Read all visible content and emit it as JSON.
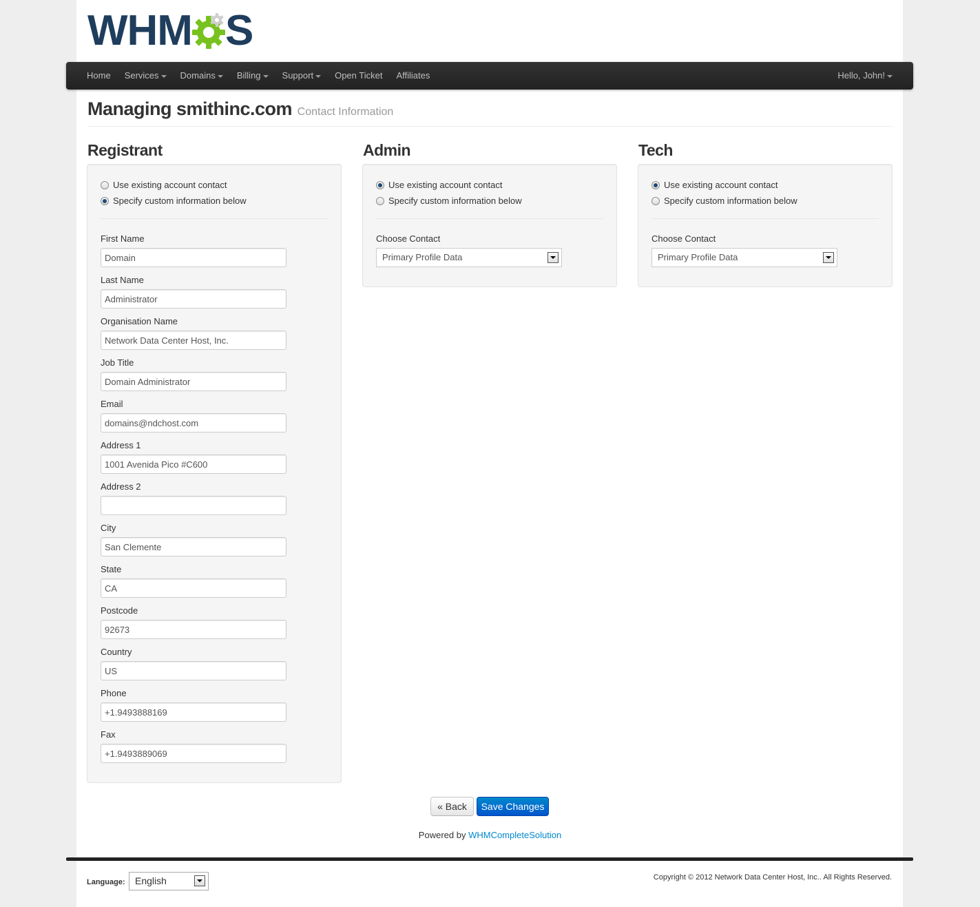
{
  "logo": {
    "text_left": "WHM",
    "text_right": "S",
    "alt": "WHMCS"
  },
  "navbar": {
    "items": [
      {
        "label": "Home",
        "dropdown": false
      },
      {
        "label": "Services",
        "dropdown": true
      },
      {
        "label": "Domains",
        "dropdown": true
      },
      {
        "label": "Billing",
        "dropdown": true
      },
      {
        "label": "Support",
        "dropdown": true
      },
      {
        "label": "Open Ticket",
        "dropdown": false
      },
      {
        "label": "Affiliates",
        "dropdown": false
      }
    ],
    "user_menu": "Hello, John!"
  },
  "header": {
    "title": "Managing smithinc.com",
    "subtitle": "Contact Information"
  },
  "registrant": {
    "title": "Registrant",
    "option_existing": "Use existing account contact",
    "option_custom": "Specify custom information below",
    "selected": "custom",
    "fields": [
      {
        "label": "First Name",
        "value": "Domain"
      },
      {
        "label": "Last Name",
        "value": "Administrator"
      },
      {
        "label": "Organisation Name",
        "value": "Network Data Center Host, Inc."
      },
      {
        "label": "Job Title",
        "value": "Domain Administrator"
      },
      {
        "label": "Email",
        "value": "domains@ndchost.com"
      },
      {
        "label": "Address 1",
        "value": "1001 Avenida Pico #C600"
      },
      {
        "label": "Address 2",
        "value": ""
      },
      {
        "label": "City",
        "value": "San Clemente"
      },
      {
        "label": "State",
        "value": "CA"
      },
      {
        "label": "Postcode",
        "value": "92673"
      },
      {
        "label": "Country",
        "value": "US"
      },
      {
        "label": "Phone",
        "value": "+1.9493888169"
      },
      {
        "label": "Fax",
        "value": "+1.9493889069"
      }
    ]
  },
  "admin": {
    "title": "Admin",
    "option_existing": "Use existing account contact",
    "option_custom": "Specify custom information below",
    "selected": "existing",
    "choose_label": "Choose Contact",
    "choose_value": "Primary Profile Data"
  },
  "tech": {
    "title": "Tech",
    "option_existing": "Use existing account contact",
    "option_custom": "Specify custom information below",
    "selected": "existing",
    "choose_label": "Choose Contact",
    "choose_value": "Primary Profile Data"
  },
  "actions": {
    "back": "« Back",
    "save": "Save Changes"
  },
  "powered": {
    "prefix": "Powered by",
    "link": "WHMCompleteSolution"
  },
  "footer": {
    "language_label": "Language:",
    "language_value": "English",
    "copyright": "Copyright © 2012 Network Data Center Host, Inc.. All Rights Reserved."
  },
  "colors": {
    "logo_blue": "#1f3d5c",
    "logo_gear": "#78c21f",
    "link": "#0088cc",
    "primary_button": "#0066cc"
  }
}
